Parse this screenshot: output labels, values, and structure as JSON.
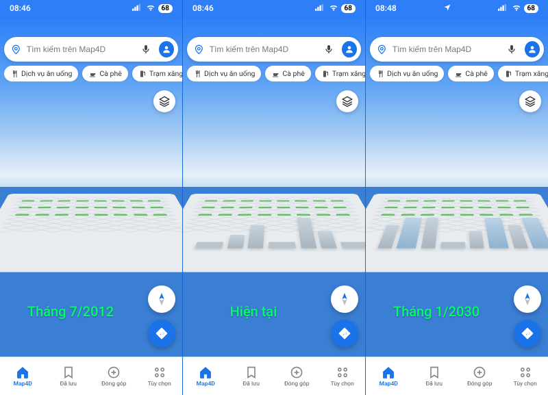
{
  "screens": [
    {
      "time": "08:46",
      "battery": "68",
      "search_placeholder": "Tìm kiếm trên Map4D",
      "chips": [
        "Dịch vụ ăn uống",
        "Cà phê",
        "Trạm xăng"
      ],
      "caption": "Tháng 7/2012",
      "building_density": "low"
    },
    {
      "time": "08:46",
      "battery": "68",
      "search_placeholder": "Tìm kiếm trên Map4D",
      "chips": [
        "Dịch vụ ăn uống",
        "Cà phê",
        "Trạm xăng"
      ],
      "caption": "Hiện tại",
      "building_density": "medium"
    },
    {
      "time": "08:48",
      "battery": "68",
      "search_placeholder": "Tìm kiếm trên Map4D",
      "chips": [
        "Dịch vụ ăn uống",
        "Cà phê",
        "Trạm xăng"
      ],
      "caption": "Tháng 1/2030",
      "building_density": "high"
    }
  ],
  "nav": {
    "items": [
      {
        "label": "Map4D",
        "active": true
      },
      {
        "label": "Đã lưu",
        "active": false
      },
      {
        "label": "Đóng góp",
        "active": false
      },
      {
        "label": "Tùy chọn",
        "active": false
      }
    ]
  },
  "icons": {
    "signal": "▪▫",
    "wifi": "wifi",
    "location_arrow": "loc"
  }
}
